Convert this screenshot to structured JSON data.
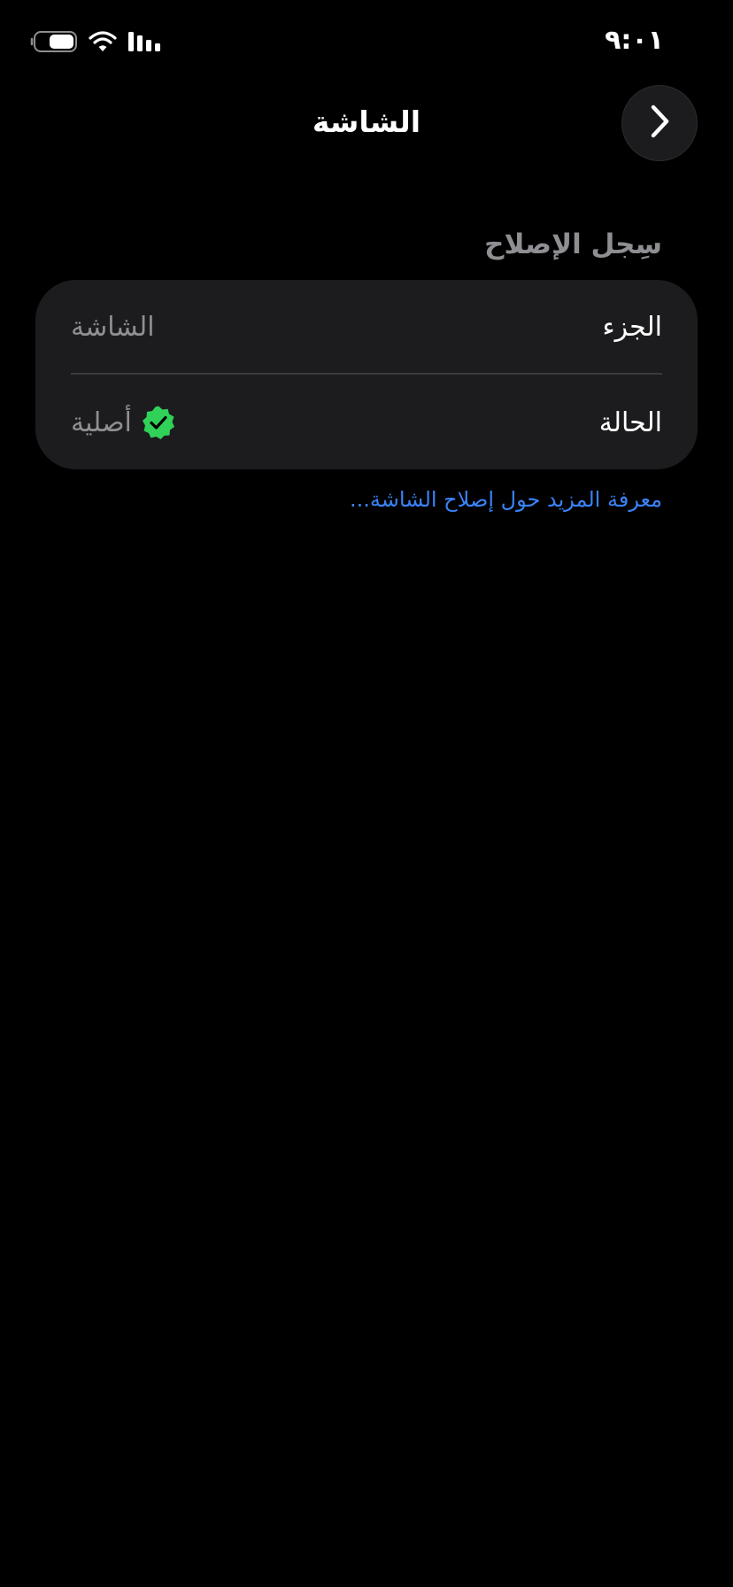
{
  "status_bar": {
    "time": "٩:٠١",
    "battery_icon": "battery-icon",
    "wifi_icon": "wifi-icon",
    "signal_icon": "cellular-signal-icon"
  },
  "nav": {
    "title": "الشاشة",
    "back_icon": "chevron-right-icon"
  },
  "section": {
    "header": "سِجل الإصلاح"
  },
  "card": {
    "rows": [
      {
        "label": "الجزء",
        "value": "الشاشة"
      },
      {
        "label": "الحالة",
        "value": "أصلية",
        "icon": "verified-checkmark-icon"
      }
    ]
  },
  "footer": {
    "link": "معرفة المزيد حول إصلاح الشاشة..."
  },
  "colors": {
    "background": "#000000",
    "card": "#1c1c1e",
    "secondary_text": "#8e8e93",
    "link": "#3a82f7",
    "verified_green": "#30d158"
  }
}
